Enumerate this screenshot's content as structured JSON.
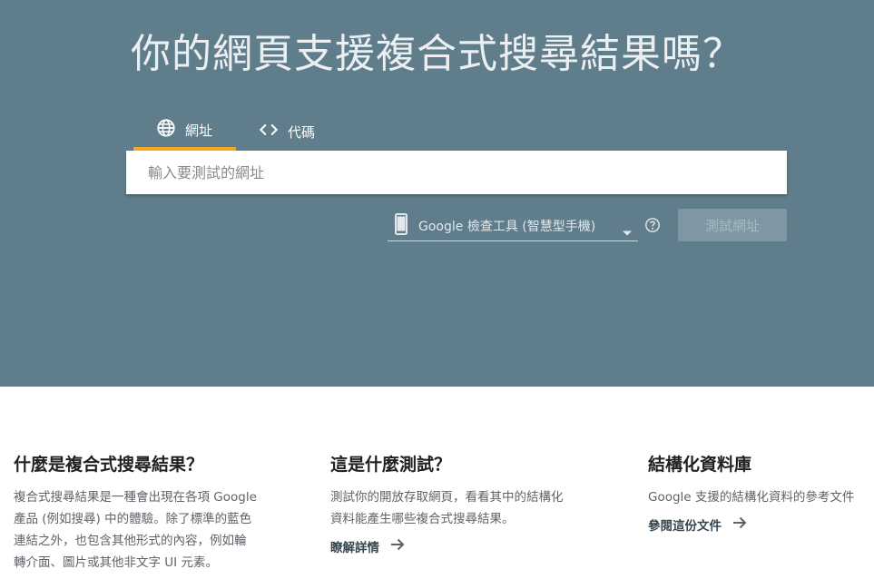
{
  "hero": {
    "title": "你的網頁支援複合式搜尋結果嗎？",
    "background": "#607d8b",
    "tabs": [
      {
        "label": "網址",
        "icon": "globe-icon",
        "active": true
      },
      {
        "label": "代碼",
        "icon": "code-icon",
        "active": false
      }
    ],
    "tab_indicator_color": "#f5a623",
    "url_input": {
      "placeholder": "輸入要測試的網址",
      "value": ""
    },
    "user_agent": {
      "selected": "Google 檢查工具 (智慧型手機)",
      "icon": "smartphone-icon"
    },
    "help_icon": "help-circle-icon",
    "test_button": {
      "label": "測試網址",
      "disabled": true
    }
  },
  "info": [
    {
      "heading": "什麼是複合式搜尋結果？",
      "body_lines": [
        "複合式搜尋結果是一種會出現在各項 Google",
        "產品 (例如搜尋) 中的體驗。除了標準的藍色",
        "連結之外，也包含其他形式的內容，例如輪",
        "轉介面、圖片或其他非文字 UI 元素。"
      ]
    },
    {
      "heading": "這是什麼測試？",
      "body_lines": [
        "測試你的開放存取網頁，看看其中的結構化",
        "資料能產生哪些複合式搜尋結果。"
      ],
      "link": "瞭解詳情"
    },
    {
      "heading": "結構化資料庫",
      "body_lines": [
        "Google 支援的結構化資料的參考文件"
      ],
      "link": "參閱這份文件"
    }
  ]
}
